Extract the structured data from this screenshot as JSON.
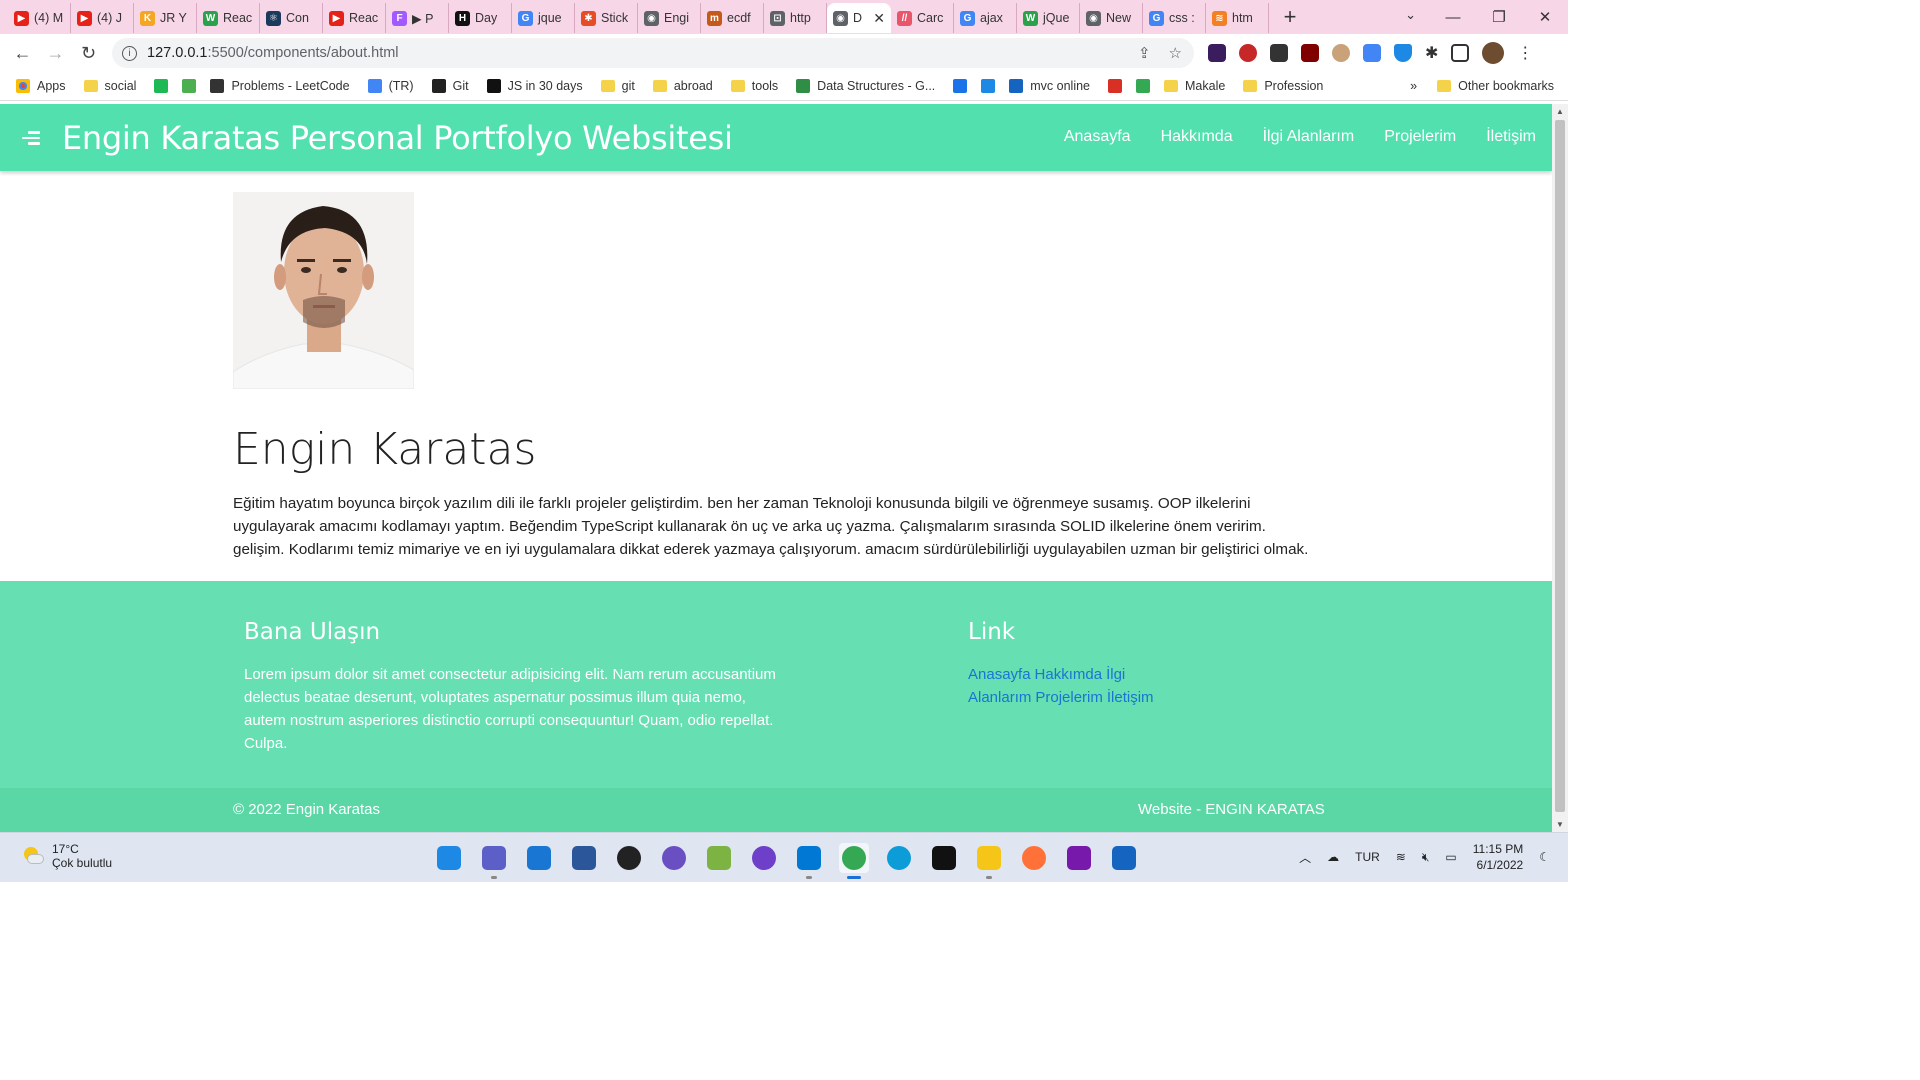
{
  "browser": {
    "tabs": [
      {
        "label": "(4) M",
        "color": "#e62117",
        "glyph": "▶"
      },
      {
        "label": "(4) J",
        "color": "#e62117",
        "glyph": "▶"
      },
      {
        "label": "JR Y",
        "color": "#f5a623",
        "glyph": "K"
      },
      {
        "label": "Reac",
        "color": "#2ba14b",
        "glyph": "W"
      },
      {
        "label": "Con",
        "color": "#1c3a5c",
        "glyph": "⚛"
      },
      {
        "label": "Reac",
        "color": "#e62117",
        "glyph": "▶"
      },
      {
        "label": "▶ P",
        "color": "#a259ff",
        "glyph": "F"
      },
      {
        "label": "Day",
        "color": "#111111",
        "glyph": "H"
      },
      {
        "label": "jque",
        "color": "#4285f4",
        "glyph": "G"
      },
      {
        "label": "Stick",
        "color": "#e44d26",
        "glyph": "✱"
      },
      {
        "label": "Engi",
        "color": "#5f6368",
        "glyph": "◉"
      },
      {
        "label": "ecdf",
        "color": "#c45a1a",
        "glyph": "m"
      },
      {
        "label": "http",
        "color": "#5f6368",
        "glyph": "⊡"
      },
      {
        "label": "D",
        "color": "#5f6368",
        "glyph": "◉"
      },
      {
        "label": "Carc",
        "color": "#e8566c",
        "glyph": "//"
      },
      {
        "label": "ajax",
        "color": "#4285f4",
        "glyph": "G"
      },
      {
        "label": "jQue",
        "color": "#2ba14b",
        "glyph": "W"
      },
      {
        "label": "New",
        "color": "#5f6368",
        "glyph": "◉"
      },
      {
        "label": "css :",
        "color": "#4285f4",
        "glyph": "G"
      },
      {
        "label": "htm",
        "color": "#f48024",
        "glyph": "≋"
      }
    ],
    "active_tab_index": 13,
    "new_tab": "+",
    "url_host": "127.0.0.1",
    "url_path": ":5500/components/about.html",
    "bookmarks": [
      {
        "label": "Apps",
        "type": "apps"
      },
      {
        "label": "social",
        "type": "folder"
      },
      {
        "label": "",
        "type": "icon",
        "color": "#1db954"
      },
      {
        "label": "",
        "type": "icon",
        "color": "#4caf50"
      },
      {
        "label": "Problems - LeetCode",
        "type": "icon",
        "color": "#333333"
      },
      {
        "label": "(TR)",
        "type": "icon",
        "color": "#4285f4"
      },
      {
        "label": "Git",
        "type": "icon",
        "color": "#222222"
      },
      {
        "label": "JS in 30 days",
        "type": "icon",
        "color": "#111111"
      },
      {
        "label": "git",
        "type": "folder"
      },
      {
        "label": "abroad",
        "type": "folder"
      },
      {
        "label": "tools",
        "type": "folder"
      },
      {
        "label": "Data Structures - G...",
        "type": "icon",
        "color": "#2f8d46"
      },
      {
        "label": "",
        "type": "icon",
        "color": "#1a73e8"
      },
      {
        "label": "",
        "type": "icon",
        "color": "#1e88e5"
      },
      {
        "label": "mvc online",
        "type": "icon",
        "color": "#1565c0"
      },
      {
        "label": "",
        "type": "icon",
        "color": "#d93025"
      },
      {
        "label": "",
        "type": "icon",
        "color": "#34a853"
      },
      {
        "label": "Makale",
        "type": "folder"
      },
      {
        "label": "Profession",
        "type": "folder"
      }
    ],
    "more_bookmarks": "»",
    "other_bookmarks": "Other bookmarks"
  },
  "site": {
    "title": "Engin Karatas Personal Portfolyo Websitesi",
    "nav": [
      "Anasayfa",
      "Hakkımda",
      "İlgi Alanlarım",
      "Projelerim",
      "İletişim"
    ],
    "name": "Engin Karatas",
    "bio": "Eğitim hayatım boyunca birçok yazılım dili ile farklı projeler geliştirdim. ben her zaman Teknoloji konusunda bilgili ve öğrenmeye susamış. OOP ilkelerini uygulayarak amacımı kodlamayı yaptım. Beğendim TypeScript kullanarak ön uç ve arka uç yazma. Çalışmalarım sırasında SOLID ilkelerine önem veririm. gelişim. Kodlarımı temiz mimariye ve en iyi uygulamalara dikkat ederek yazmaya çalışıyorum. amacım sürdürülebilirliği uygulayabilen uzman bir geliştirici olmak.",
    "footer": {
      "contact_title": "Bana Ulaşın",
      "contact_text": "Lorem ipsum dolor sit amet consectetur adipisicing elit. Nam rerum accusantium delectus beatae deserunt, voluptates aspernatur possimus illum quia nemo, autem nostrum asperiores distinctio corrupti consequuntur! Quam, odio repellat. Culpa.",
      "links_title": "Link",
      "links": [
        "Anasayfa",
        "Hakkımda",
        "İlgi Alanlarım",
        "Projelerim",
        "İletişim"
      ],
      "copyright": "© 2022 Engin Karatas",
      "credit": "Website - ENGIN KARATAS"
    },
    "colors": {
      "navbar": "#52e0af",
      "footer": "#66dfb2",
      "link": "#1a75d2"
    }
  },
  "taskbar": {
    "weather_temp": "17°C",
    "weather_desc": "Çok bulutlu",
    "apps": [
      {
        "name": "windows-start",
        "color": "#1e88e5"
      },
      {
        "name": "teams",
        "color": "#5b5fc7"
      },
      {
        "name": "mail",
        "color": "#1976d2"
      },
      {
        "name": "wordpad",
        "color": "#2b579a"
      },
      {
        "name": "media-player",
        "color": "#222222"
      },
      {
        "name": "github-desktop",
        "color": "#6a4fc2"
      },
      {
        "name": "notepad-plus",
        "color": "#7cb342"
      },
      {
        "name": "github",
        "color": "#6e40c9"
      },
      {
        "name": "vscode",
        "color": "#0078d4"
      },
      {
        "name": "chrome",
        "color": "#34a853"
      },
      {
        "name": "edge",
        "color": "#0c9cd8"
      },
      {
        "name": "intellij",
        "color": "#111111"
      },
      {
        "name": "file-explorer",
        "color": "#f5c518"
      },
      {
        "name": "firefox",
        "color": "#ff7139"
      },
      {
        "name": "onenote",
        "color": "#7719aa"
      },
      {
        "name": "calendar",
        "color": "#1565c0"
      }
    ],
    "active_app_index": 9,
    "lang": "TUR",
    "time": "11:15 PM",
    "date": "6/1/2022"
  }
}
